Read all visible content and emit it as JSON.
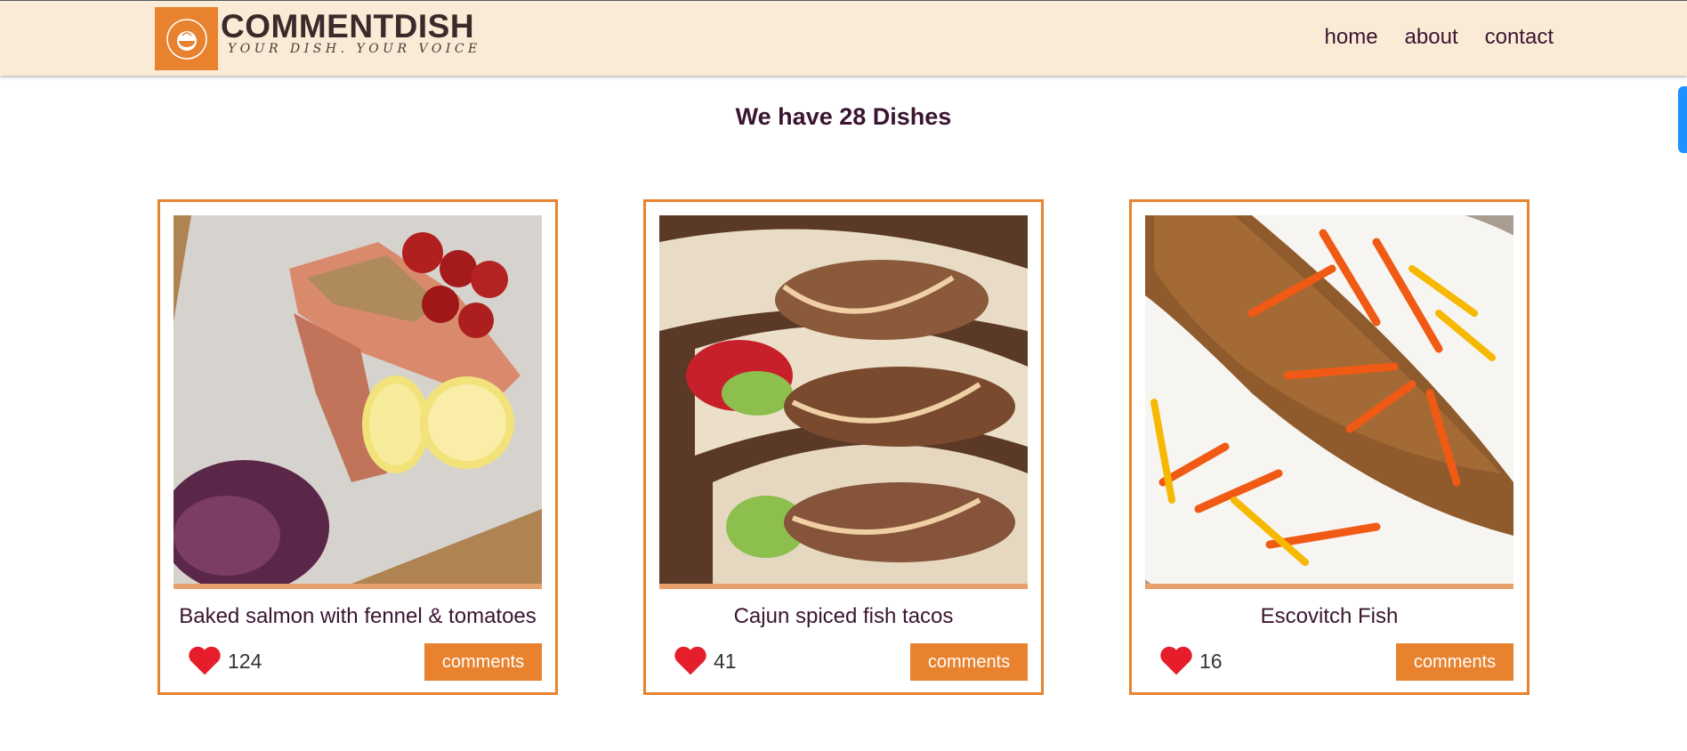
{
  "brand": {
    "name": "COMMENTDISH",
    "tagline": "YOUR DISH. YOUR VOICE",
    "seal_text": "COMMENTDISH",
    "accent_color": "#e8822e",
    "header_bg": "#faebd7"
  },
  "nav": {
    "items": [
      "home",
      "about",
      "contact"
    ]
  },
  "main": {
    "heading": "We have 28 Dishes"
  },
  "comments_label": "comments",
  "heart_icon": "heart-icon",
  "dishes": [
    {
      "name": "Baked salmon with fennel & tomatoes",
      "likes": "124"
    },
    {
      "name": "Cajun spiced fish tacos",
      "likes": "41"
    },
    {
      "name": "Escovitch Fish",
      "likes": "16"
    }
  ]
}
